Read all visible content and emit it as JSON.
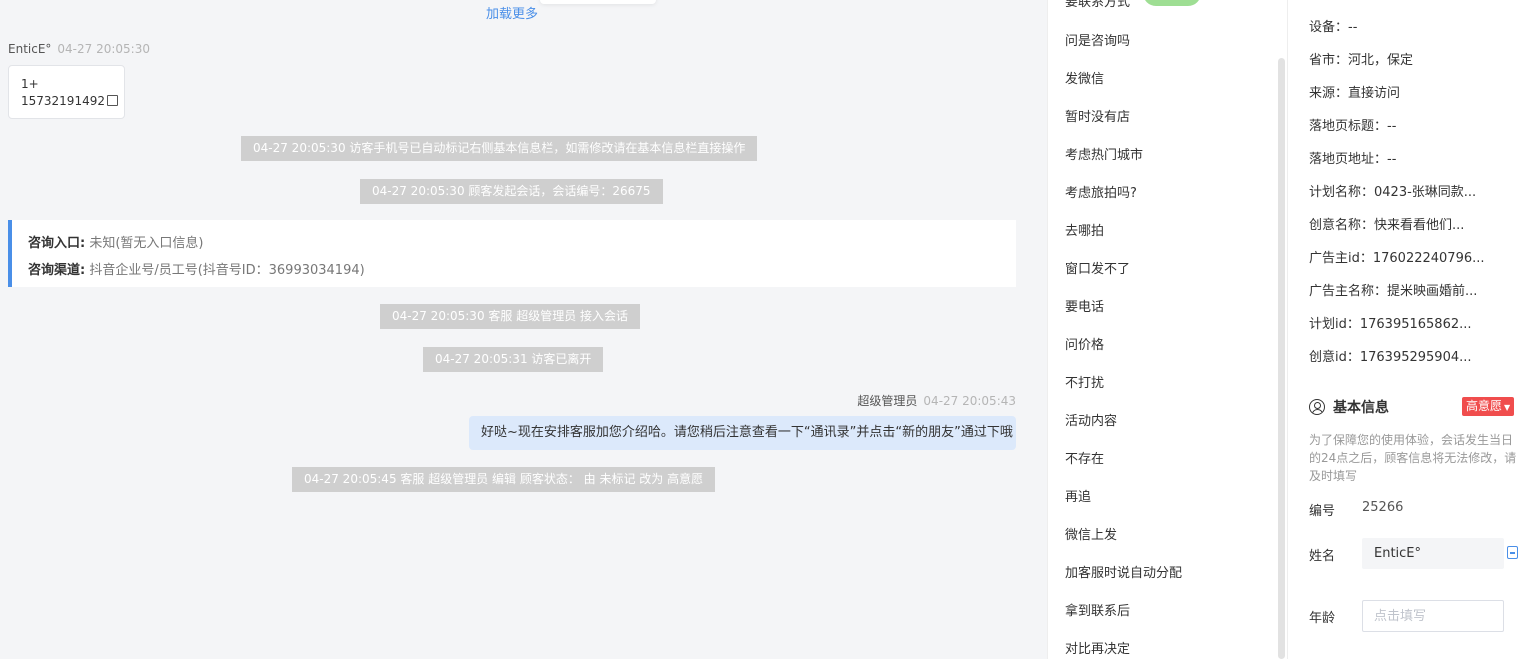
{
  "chat": {
    "load_more": "加载更多",
    "visitor_name": "EnticE°",
    "visitor_time": "04-27 20:05:30",
    "visitor_card_line1": "1+",
    "visitor_card_line2": "15732191492",
    "system_messages": [
      "04-27 20:05:30 访客手机号已自动标记右侧基本信息栏，如需修改请在基本信息栏直接操作",
      "04-27 20:05:30 顾客发起会话，会话编号：26675",
      "04-27 20:05:30 客服 超级管理员 接入会话",
      "04-27 20:05:31 访客已离开",
      "04-27 20:05:45 客服 超级管理员 编辑 顾客状态： 由 未标记 改为 高意愿"
    ],
    "entry_label": "咨询入口:",
    "entry_value": "未知(暂无入口信息)",
    "channel_label": "咨询渠道:",
    "channel_value": "抖音企业号/员工号(抖音号ID：36993034194)",
    "agent_name": "超级管理员",
    "agent_time": "04-27 20:05:43",
    "agent_message": "好哒~现在安排客服加您介绍哈。请您稍后注意查看一下“通讯录”并点击“新的朋友”通过下哦"
  },
  "quick_replies": {
    "top_partial": "要联系方式",
    "items": [
      "问是咨询吗",
      "发微信",
      "暂时没有店",
      "考虑热门城市",
      "考虑旅拍吗?",
      "去哪拍",
      "窗口发不了",
      "要电话",
      "问价格",
      "不打扰",
      "活动内容",
      "不存在",
      "再追",
      "微信上发",
      "加客服时说自动分配",
      "拿到联系后",
      "对比再决定"
    ]
  },
  "panel": {
    "source_rows": [
      "设备：--",
      "省市：河北，保定",
      "来源：直接访问",
      "落地页标题：--",
      "落地页地址：--",
      "计划名称：0423-张琳同款...",
      "创意名称：快来看看他们...",
      "广告主id：176022240796...",
      "广告主名称：提米映画婚前...",
      "计划id：176395165862...",
      "创意id：176395295904..."
    ],
    "basic_info_title": "基本信息",
    "intent_badge": "高意愿",
    "notice": "为了保障您的使用体验，会话发生当日的24点之后，顾客信息将无法修改，请及时填写",
    "id_label": "编号",
    "id_value": "25266",
    "name_label": "姓名",
    "name_value": "EnticE°",
    "age_label": "年龄",
    "age_placeholder": "点击填写"
  }
}
